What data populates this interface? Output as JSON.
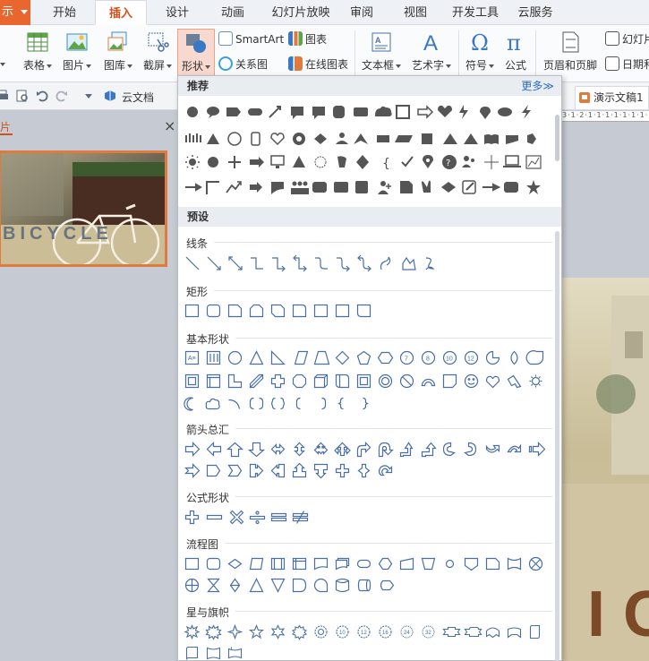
{
  "app_button": {
    "label": "示"
  },
  "tabs": [
    {
      "label": "开始",
      "active": false
    },
    {
      "label": "插入",
      "active": true
    },
    {
      "label": "设计",
      "active": false
    },
    {
      "label": "动画",
      "active": false
    },
    {
      "label": "幻灯片放映",
      "active": false
    },
    {
      "label": "审阅",
      "active": false
    },
    {
      "label": "视图",
      "active": false
    },
    {
      "label": "开发工具",
      "active": false
    },
    {
      "label": "云服务",
      "active": false
    }
  ],
  "ribbon": {
    "table": "表格",
    "picture": "图片",
    "gallery": "图库",
    "screenshot": "截屏",
    "shapes": "形状",
    "smartart": "SmartArt",
    "chart": "图表",
    "relation": "关系图",
    "online_chart": "在线图表",
    "textbox": "文本框",
    "wordart": "艺术字",
    "symbol": "符号",
    "formula": "公式",
    "header_footer": "页眉和页脚",
    "slide_num": "幻灯片",
    "datetime": "日期和"
  },
  "quickbar": {
    "cloud_doc": "云文档",
    "doc_tab": "演示文稿1"
  },
  "left_panel": {
    "title": "片",
    "close": "×",
    "thumb_text": "BICYCLE"
  },
  "ruler_text": "3·1·2·1·1·1·1·1·1·1·1",
  "slide_text": "I C",
  "dropdown": {
    "recommended": "推荐",
    "more": "更多≫",
    "preset": "预设",
    "sections": {
      "lines": "线条",
      "rect": "矩形",
      "basic": "基本形状",
      "arrows": "箭头总汇",
      "formula": "公式形状",
      "flowchart": "流程图",
      "stars": "星与旗帜"
    },
    "basic_labels": [
      "7",
      "8",
      "10",
      "12"
    ]
  },
  "colors": {
    "accent": "#e9672e",
    "tab_active_text": "#d2501f",
    "shape_stroke": "#4a6fa5",
    "recommended_fill": "#555555",
    "link": "#2b6cc4"
  }
}
